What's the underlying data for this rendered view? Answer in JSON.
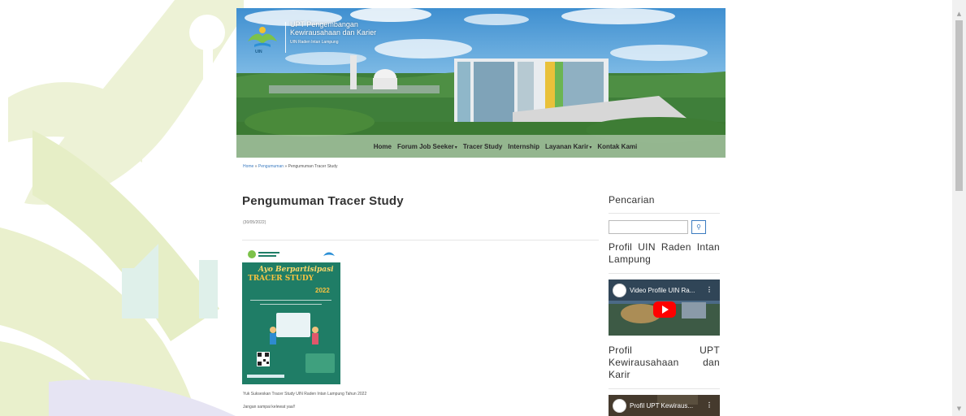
{
  "header": {
    "org_line1": "UPT Pengembangan",
    "org_line2": "Kewirausahaan dan Karier",
    "org_line3": "UIN Raden Intan Lampung"
  },
  "nav": {
    "items": [
      {
        "label": "Home",
        "dropdown": false
      },
      {
        "label": "Forum Job Seeker",
        "dropdown": true
      },
      {
        "label": "Tracer Study",
        "dropdown": false
      },
      {
        "label": "Internship",
        "dropdown": false
      },
      {
        "label": "Layanan Karir",
        "dropdown": true
      },
      {
        "label": "Kontak Kami",
        "dropdown": false
      }
    ]
  },
  "breadcrumb": {
    "home": "Home",
    "sep": " » ",
    "section": "Pengumuman",
    "current": "Pengumuman Tracer Study"
  },
  "post": {
    "title": "Pengumuman Tracer Study",
    "date": "(30/05/2022)",
    "poster": {
      "headline": "Ayo Berpartisipasi",
      "subhead": "TRACER STUDY",
      "year": "2022"
    },
    "caption1": "Yuk Sukseskan Tracer Study UIN Raden Intan Lampung Tahun 2022",
    "caption2": "Jangan sampai kelewat yaa!!"
  },
  "sidebar": {
    "search_heading": "Pencarian",
    "search_placeholder": "",
    "search_icon": "search-icon",
    "profile_uin_heading": "Profil UIN Raden Intan Lampung",
    "video1_title": "Video Profile UIN Ra...",
    "profile_upt_heading": "Profil UPT Kewirausahaan dan Karir",
    "video2_title": "Profil UPT Kewiraus..."
  },
  "colors": {
    "accent": "#3b7bc0",
    "poster_green": "#1f7d66",
    "watermark_green": "#e4ecc0",
    "watermark_teal": "#d8efe9",
    "youtube_red": "#ff0000"
  }
}
